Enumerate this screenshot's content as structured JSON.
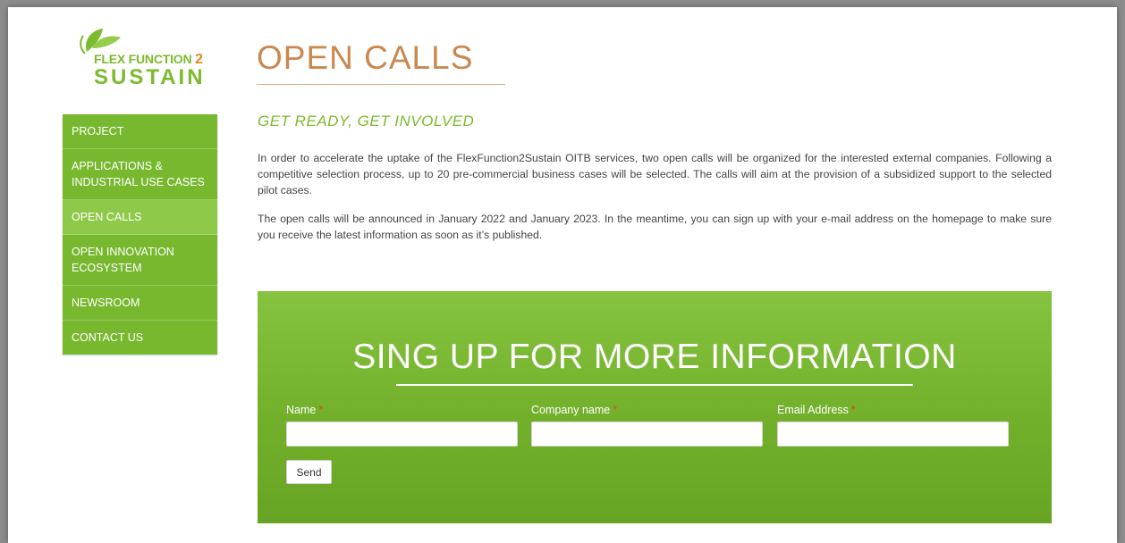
{
  "logo": {
    "line1": "FLEX FUNCTION",
    "line1_num": "2",
    "line2": "SUSTAIN"
  },
  "sidebar": {
    "items": [
      {
        "label": "PROJECT"
      },
      {
        "label": "APPLICATIONS & INDUSTRIAL USE CASES"
      },
      {
        "label": "OPEN CALLS",
        "active": true
      },
      {
        "label": "OPEN INNOVATION ECOSYSTEM"
      },
      {
        "label": "NEWSROOM"
      },
      {
        "label": "CONTACT US"
      }
    ]
  },
  "main": {
    "title": "OPEN CALLS",
    "subtitle": "GET READY, GET INVOLVED",
    "paragraph1": "In order to accelerate the uptake of the FlexFunction2Sustain OITB services, two open calls will be organized for the interested external companies. Following a competitive selection process, up to 20 pre-commercial business cases will be selected. The calls will aim at the provision of a subsidized support to the selected pilot cases.",
    "paragraph2": "The open calls will be announced in January 2022 and January 2023. In the meantime, you can sign up with your e-mail address on the homepage to make sure you receive the latest information as soon as it’s published."
  },
  "signup": {
    "title": "SING UP FOR MORE INFORMATION",
    "fields": [
      {
        "label": "Name",
        "required_mark": "*",
        "value": ""
      },
      {
        "label": "Company name",
        "required_mark": "*",
        "value": ""
      },
      {
        "label": "Email Address",
        "required_mark": "*",
        "value": ""
      }
    ],
    "send_label": "Send"
  },
  "colors": {
    "brand_green": "#78b82f",
    "title_orange": "#c9884f",
    "required_red": "#e8441e"
  }
}
